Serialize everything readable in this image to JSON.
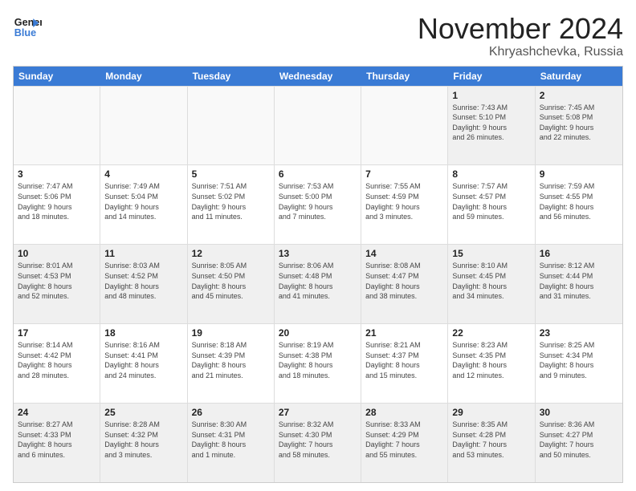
{
  "logo": {
    "line1": "General",
    "line2": "Blue"
  },
  "header": {
    "month": "November 2024",
    "location": "Khryashchevka, Russia"
  },
  "weekdays": [
    "Sunday",
    "Monday",
    "Tuesday",
    "Wednesday",
    "Thursday",
    "Friday",
    "Saturday"
  ],
  "rows": [
    [
      {
        "day": "",
        "info": ""
      },
      {
        "day": "",
        "info": ""
      },
      {
        "day": "",
        "info": ""
      },
      {
        "day": "",
        "info": ""
      },
      {
        "day": "",
        "info": ""
      },
      {
        "day": "1",
        "info": "Sunrise: 7:43 AM\nSunset: 5:10 PM\nDaylight: 9 hours\nand 26 minutes."
      },
      {
        "day": "2",
        "info": "Sunrise: 7:45 AM\nSunset: 5:08 PM\nDaylight: 9 hours\nand 22 minutes."
      }
    ],
    [
      {
        "day": "3",
        "info": "Sunrise: 7:47 AM\nSunset: 5:06 PM\nDaylight: 9 hours\nand 18 minutes."
      },
      {
        "day": "4",
        "info": "Sunrise: 7:49 AM\nSunset: 5:04 PM\nDaylight: 9 hours\nand 14 minutes."
      },
      {
        "day": "5",
        "info": "Sunrise: 7:51 AM\nSunset: 5:02 PM\nDaylight: 9 hours\nand 11 minutes."
      },
      {
        "day": "6",
        "info": "Sunrise: 7:53 AM\nSunset: 5:00 PM\nDaylight: 9 hours\nand 7 minutes."
      },
      {
        "day": "7",
        "info": "Sunrise: 7:55 AM\nSunset: 4:59 PM\nDaylight: 9 hours\nand 3 minutes."
      },
      {
        "day": "8",
        "info": "Sunrise: 7:57 AM\nSunset: 4:57 PM\nDaylight: 8 hours\nand 59 minutes."
      },
      {
        "day": "9",
        "info": "Sunrise: 7:59 AM\nSunset: 4:55 PM\nDaylight: 8 hours\nand 56 minutes."
      }
    ],
    [
      {
        "day": "10",
        "info": "Sunrise: 8:01 AM\nSunset: 4:53 PM\nDaylight: 8 hours\nand 52 minutes."
      },
      {
        "day": "11",
        "info": "Sunrise: 8:03 AM\nSunset: 4:52 PM\nDaylight: 8 hours\nand 48 minutes."
      },
      {
        "day": "12",
        "info": "Sunrise: 8:05 AM\nSunset: 4:50 PM\nDaylight: 8 hours\nand 45 minutes."
      },
      {
        "day": "13",
        "info": "Sunrise: 8:06 AM\nSunset: 4:48 PM\nDaylight: 8 hours\nand 41 minutes."
      },
      {
        "day": "14",
        "info": "Sunrise: 8:08 AM\nSunset: 4:47 PM\nDaylight: 8 hours\nand 38 minutes."
      },
      {
        "day": "15",
        "info": "Sunrise: 8:10 AM\nSunset: 4:45 PM\nDaylight: 8 hours\nand 34 minutes."
      },
      {
        "day": "16",
        "info": "Sunrise: 8:12 AM\nSunset: 4:44 PM\nDaylight: 8 hours\nand 31 minutes."
      }
    ],
    [
      {
        "day": "17",
        "info": "Sunrise: 8:14 AM\nSunset: 4:42 PM\nDaylight: 8 hours\nand 28 minutes."
      },
      {
        "day": "18",
        "info": "Sunrise: 8:16 AM\nSunset: 4:41 PM\nDaylight: 8 hours\nand 24 minutes."
      },
      {
        "day": "19",
        "info": "Sunrise: 8:18 AM\nSunset: 4:39 PM\nDaylight: 8 hours\nand 21 minutes."
      },
      {
        "day": "20",
        "info": "Sunrise: 8:19 AM\nSunset: 4:38 PM\nDaylight: 8 hours\nand 18 minutes."
      },
      {
        "day": "21",
        "info": "Sunrise: 8:21 AM\nSunset: 4:37 PM\nDaylight: 8 hours\nand 15 minutes."
      },
      {
        "day": "22",
        "info": "Sunrise: 8:23 AM\nSunset: 4:35 PM\nDaylight: 8 hours\nand 12 minutes."
      },
      {
        "day": "23",
        "info": "Sunrise: 8:25 AM\nSunset: 4:34 PM\nDaylight: 8 hours\nand 9 minutes."
      }
    ],
    [
      {
        "day": "24",
        "info": "Sunrise: 8:27 AM\nSunset: 4:33 PM\nDaylight: 8 hours\nand 6 minutes."
      },
      {
        "day": "25",
        "info": "Sunrise: 8:28 AM\nSunset: 4:32 PM\nDaylight: 8 hours\nand 3 minutes."
      },
      {
        "day": "26",
        "info": "Sunrise: 8:30 AM\nSunset: 4:31 PM\nDaylight: 8 hours\nand 1 minute."
      },
      {
        "day": "27",
        "info": "Sunrise: 8:32 AM\nSunset: 4:30 PM\nDaylight: 7 hours\nand 58 minutes."
      },
      {
        "day": "28",
        "info": "Sunrise: 8:33 AM\nSunset: 4:29 PM\nDaylight: 7 hours\nand 55 minutes."
      },
      {
        "day": "29",
        "info": "Sunrise: 8:35 AM\nSunset: 4:28 PM\nDaylight: 7 hours\nand 53 minutes."
      },
      {
        "day": "30",
        "info": "Sunrise: 8:36 AM\nSunset: 4:27 PM\nDaylight: 7 hours\nand 50 minutes."
      }
    ]
  ]
}
